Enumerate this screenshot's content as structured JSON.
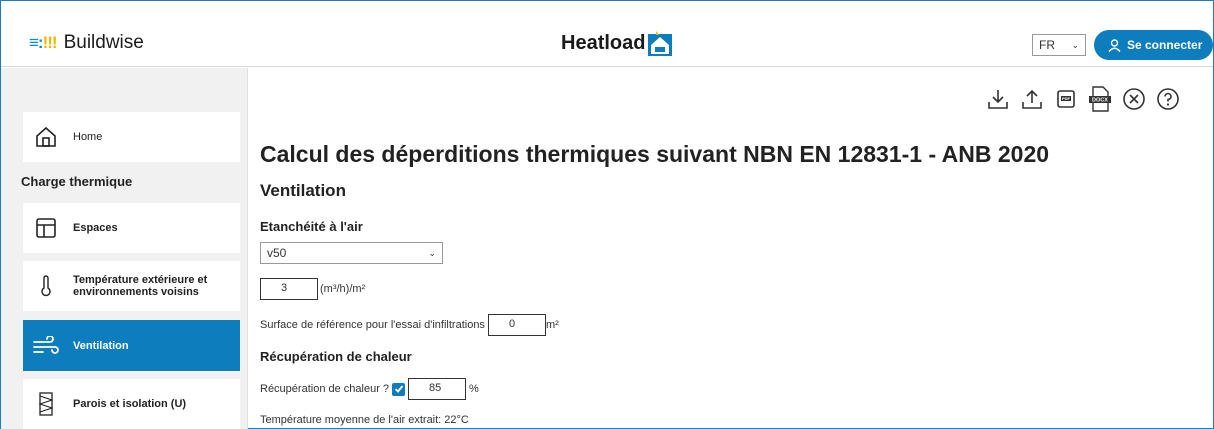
{
  "header": {
    "logo_mark": "≡:!!!",
    "logo_text": "Buildwise",
    "brand": "Heatload",
    "lang": "FR",
    "login": "Se connecter"
  },
  "sidebar": {
    "home": "Home",
    "section": "Charge thermique",
    "items": [
      {
        "label": "Espaces",
        "icon": "layout-icon"
      },
      {
        "label": "Température extérieure et environnements voisins",
        "icon": "thermometer-icon"
      },
      {
        "label": "Ventilation",
        "icon": "wind-icon",
        "active": true
      },
      {
        "label": "Parois et isolation (U)",
        "icon": "wall-insulation-icon"
      }
    ]
  },
  "toolbar": [
    "download-icon",
    "upload-icon",
    "pdf-icon",
    "docx-icon",
    "close-circle-icon",
    "help-icon"
  ],
  "main": {
    "title": "Calcul des déperditions thermiques suivant NBN EN 12831-1 - ANB 2020",
    "section": "Ventilation",
    "airtight_heading": "Etanchéité à l'air",
    "select_value": "v50",
    "v50_value": "3",
    "v50_unit": "(m³/h)/m²",
    "surface_label": "Surface de référence pour l'essai d'infiltrations",
    "surface_value": "0",
    "surface_unit": "m²",
    "recovery_heading": "Récupération de chaleur",
    "recovery_label": "Récupération de chaleur ?",
    "recovery_value": "85",
    "recovery_unit": "%",
    "note": "Température moyenne de l'air extrait: 22°C"
  },
  "colors": {
    "accent": "#0d7dbd",
    "brand_yellow": "#f2b600"
  }
}
